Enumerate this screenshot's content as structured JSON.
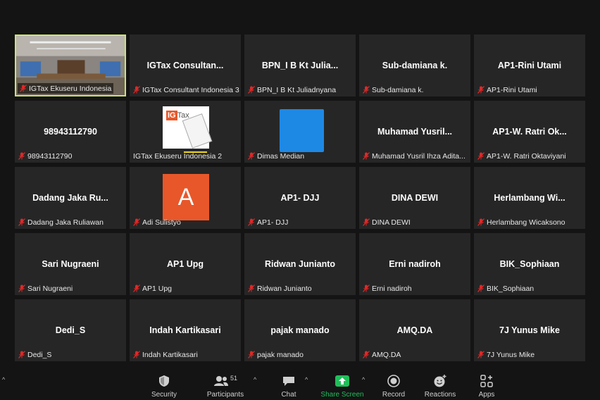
{
  "tiles": [
    {
      "big": "",
      "label": "IGTax Ekuseru Indonesia",
      "type": "video",
      "active": true
    },
    {
      "big": "IGTax Consultan...",
      "label": "IGTax Consultant Indonesia 3"
    },
    {
      "big": "BPN_I B Kt Julia...",
      "label": "BPN_I B Kt Juliadnyana"
    },
    {
      "big": "Sub-damiana k.",
      "label": "Sub-damiana k."
    },
    {
      "big": "AP1-Rini Utami",
      "label": "AP1-Rini Utami"
    },
    {
      "big": "98943112790",
      "label": "98943112790"
    },
    {
      "big": "",
      "label": "IGTax Ekuseru Indonesia 2",
      "type": "logo",
      "logo_text": "IGTax",
      "nomute": true
    },
    {
      "big": "",
      "label": "Dimas Median",
      "type": "bluebox"
    },
    {
      "big": "Muhamad  Yusril...",
      "label": "Muhamad Yusril Ihza Adita..."
    },
    {
      "big": "AP1-W. Ratri Ok...",
      "label": "AP1-W. Ratri Oktaviyani"
    },
    {
      "big": "Dadang  Jaka  Ru...",
      "label": "Dadang Jaka Ruliawan"
    },
    {
      "big": "",
      "label": "Adi Sulistyo",
      "type": "letter",
      "letter": "A"
    },
    {
      "big": "AP1- DJJ",
      "label": "AP1- DJJ"
    },
    {
      "big": "DINA DEWI",
      "label": "DINA DEWI"
    },
    {
      "big": "Herlambang  Wi...",
      "label": "Herlambang Wicaksono"
    },
    {
      "big": "Sari Nugraeni",
      "label": "Sari Nugraeni"
    },
    {
      "big": "AP1 Upg",
      "label": "AP1 Upg"
    },
    {
      "big": "Ridwan Junianto",
      "label": "Ridwan Junianto"
    },
    {
      "big": "Erni nadiroh",
      "label": "Erni nadiroh"
    },
    {
      "big": "BIK_Sophiaan",
      "label": "BIK_Sophiaan"
    },
    {
      "big": "Dedi_S",
      "label": "Dedi_S"
    },
    {
      "big": "Indah Kartikasari",
      "label": "Indah Kartikasari"
    },
    {
      "big": "pajak manado",
      "label": "pajak manado"
    },
    {
      "big": "AMQ.DA",
      "label": "AMQ.DA"
    },
    {
      "big": "7J Yunus Mike",
      "label": "7J Yunus Mike"
    }
  ],
  "toolbar": {
    "security": "Security",
    "participants": "Participants",
    "participants_count": "51",
    "chat": "Chat",
    "share": "Share Screen",
    "record": "Record",
    "reactions": "Reactions",
    "apps": "Apps"
  },
  "colors": {
    "tile_bg": "#262626",
    "active_border": "#c9e474",
    "muted_red": "#e02828",
    "share_green": "#1fbf5a",
    "avatar_orange": "#e8572a",
    "blue_avatar": "#1e88e5"
  }
}
